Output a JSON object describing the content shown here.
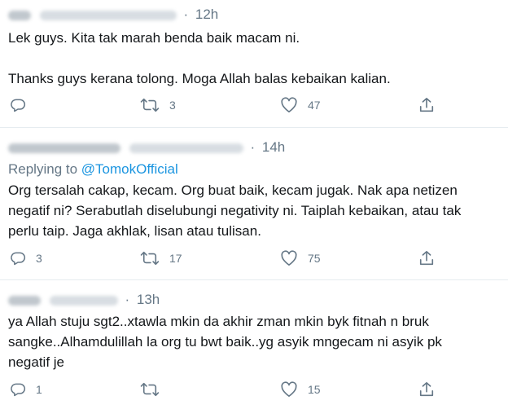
{
  "tweets": [
    {
      "time": "12h",
      "paragraphs": [
        "Lek guys. Kita tak marah benda baik macam ni.",
        "Thanks guys kerana tolong. Moga Allah balas kebaikan kalian."
      ],
      "replies": "",
      "retweets": "3",
      "likes": "47"
    },
    {
      "time": "14h",
      "replying_prefix": "Replying to",
      "replying_handle": "@TomokOfficial",
      "lines": [
        "Org tersalah cakap, kecam. Org buat baik, kecam jugak. Nak apa netizen",
        "negatif ni? Serabutlah diselubungi negativity ni. Taiplah kebaikan, atau tak",
        "perlu taip. Jaga akhlak, lisan atau tulisan."
      ],
      "replies": "3",
      "retweets": "17",
      "likes": "75"
    },
    {
      "time": "13h",
      "lines": [
        "ya Allah stuju sgt2..xtawla mkin da akhir zman mkin byk fitnah n bruk",
        "sangke..Alhamdulillah la org tu bwt baik..yg asyik mngecam ni asyik pk",
        "negatif je"
      ],
      "replies": "1",
      "retweets": "",
      "likes": "15"
    }
  ],
  "separator": "·",
  "icons": {
    "reply": "reply-icon",
    "retweet": "retweet-icon",
    "like": "like-icon",
    "share": "share-icon"
  },
  "colors": {
    "text": "#14171a",
    "muted": "#657786",
    "link": "#1b95e0",
    "divider": "#e6ecf0"
  }
}
